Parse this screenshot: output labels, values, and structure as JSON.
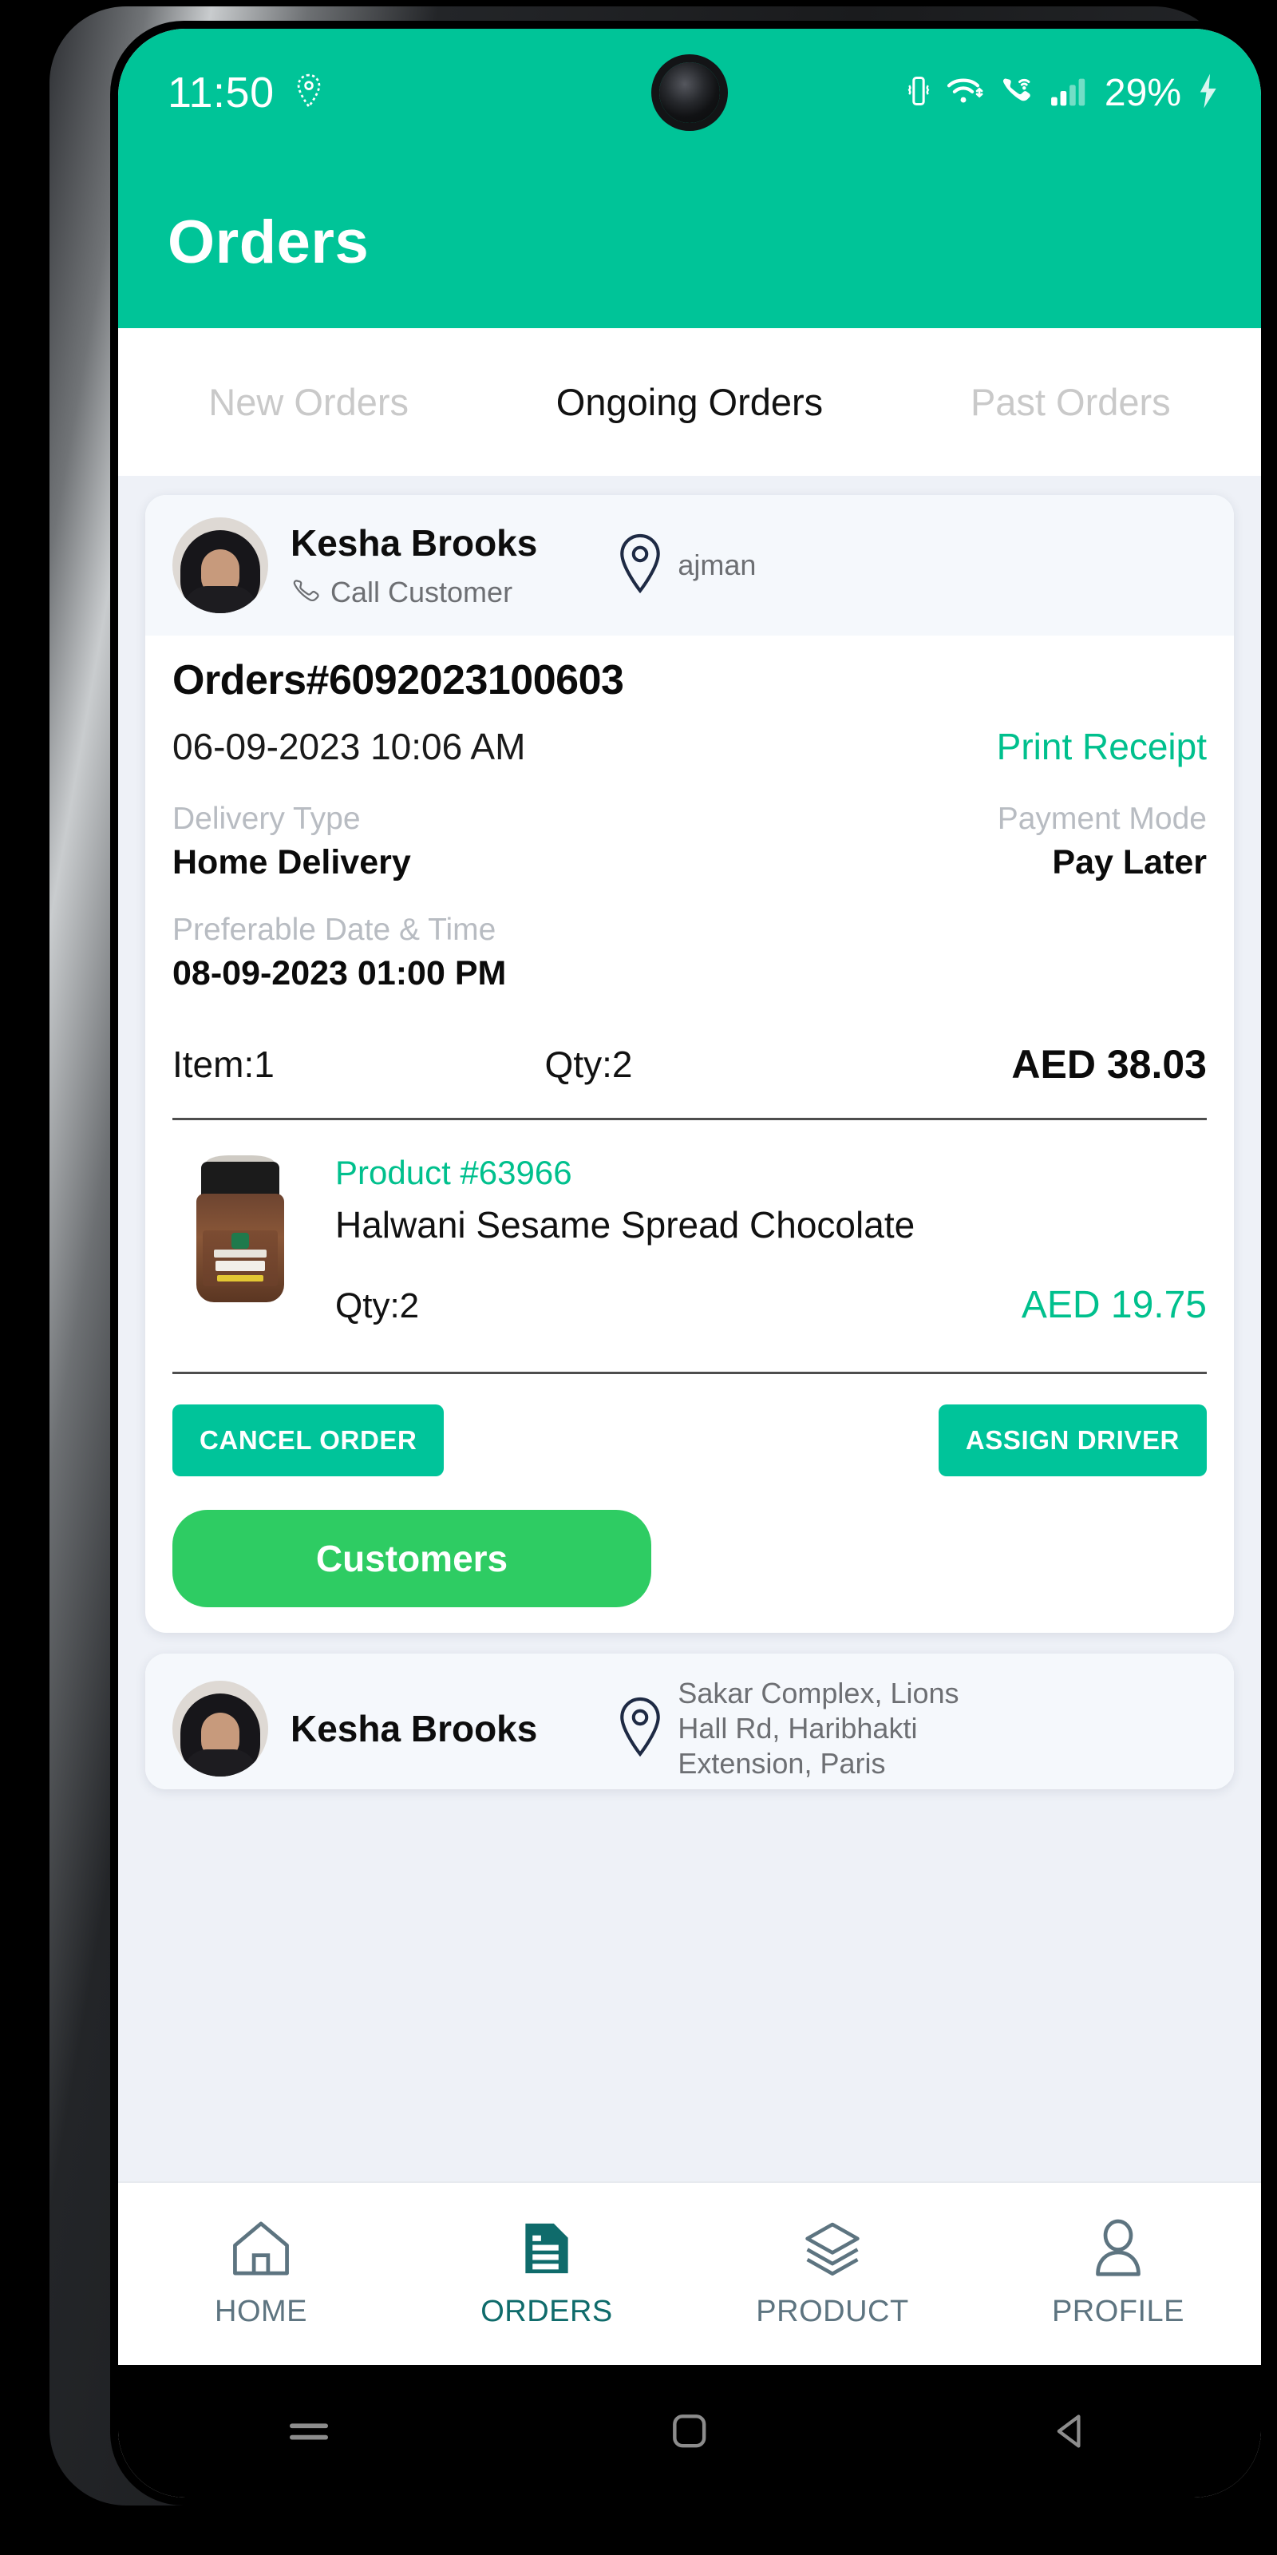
{
  "status_bar": {
    "time": "11:50",
    "battery_percent": "29%",
    "icons": [
      "location-pin-icon",
      "vibrate-icon",
      "wifi-icon",
      "wifi-calling-icon",
      "signal-bars-icon",
      "charging-bolt-icon"
    ]
  },
  "app_bar": {
    "title": "Orders"
  },
  "tabs": [
    {
      "label": "New Orders",
      "active": false
    },
    {
      "label": "Ongoing Orders",
      "active": true
    },
    {
      "label": "Past Orders",
      "active": false
    }
  ],
  "order_card": {
    "customer": {
      "name": "Kesha  Brooks",
      "call_label": "Call Customer",
      "location": "ajman"
    },
    "order_number": "Orders#6092023100603",
    "order_date": "06-09-2023 10:06 AM",
    "print_receipt": "Print Receipt",
    "delivery_type_label": "Delivery Type",
    "delivery_type_value": "Home Delivery",
    "payment_mode_label": "Payment Mode",
    "payment_mode_value": "Pay Later",
    "preferable_label": "Preferable Date & Time",
    "preferable_value": "08-09-2023 01:00 PM",
    "item_count": "Item:1",
    "qty_total": "Qty:2",
    "amount_total": "AED 38.03",
    "product": {
      "code": "Product #63966",
      "name": "Halwani Sesame Spread Chocolate",
      "qty": "Qty:2",
      "price": "AED 19.75"
    },
    "buttons": {
      "cancel": "CANCEL ORDER",
      "assign": "ASSIGN DRIVER",
      "customers": "Customers"
    }
  },
  "order_card_2": {
    "customer": {
      "name": "Kesha  Brooks",
      "location": "Sakar Complex, Lions Hall Rd, Haribhakti Extension, Paris"
    }
  },
  "bottom_nav": [
    {
      "label": "HOME",
      "icon": "home-icon",
      "active": false
    },
    {
      "label": "ORDERS",
      "icon": "orders-document-icon",
      "active": true
    },
    {
      "label": "PRODUCT",
      "icon": "layers-icon",
      "active": false
    },
    {
      "label": "PROFILE",
      "icon": "person-icon",
      "active": false
    }
  ],
  "android_nav": [
    "recents-icon",
    "home-square-icon",
    "back-triangle-icon"
  ],
  "colors": {
    "accent_teal": "#00c498",
    "link_teal": "#00c08d",
    "customers_green": "#2ecc63",
    "nav_active": "#0f6b6b"
  }
}
